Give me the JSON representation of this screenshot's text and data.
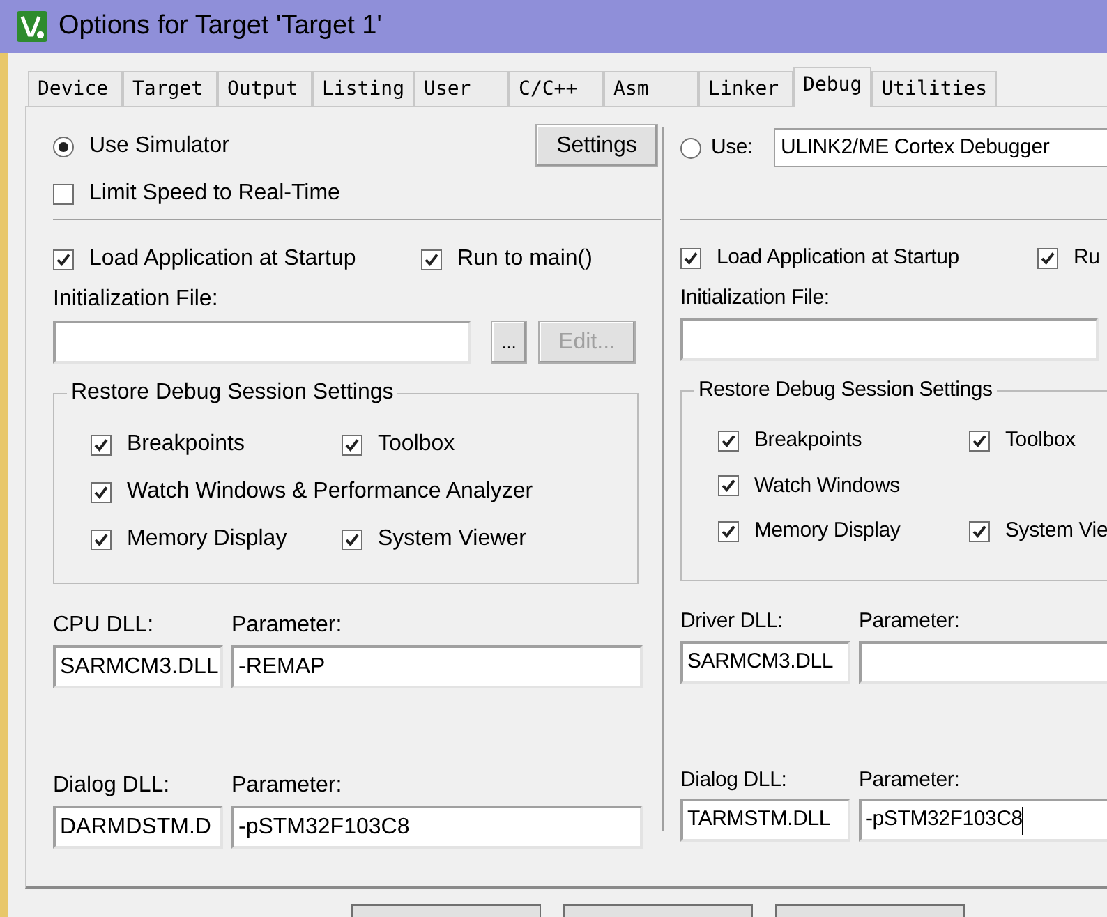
{
  "window": {
    "title": "Options for Target 'Target 1'"
  },
  "tabs": [
    {
      "label": "Device",
      "selected": false
    },
    {
      "label": "Target",
      "selected": false
    },
    {
      "label": "Output",
      "selected": false
    },
    {
      "label": "Listing",
      "selected": false
    },
    {
      "label": "User",
      "selected": false
    },
    {
      "label": "C/C++",
      "selected": false
    },
    {
      "label": "Asm",
      "selected": false
    },
    {
      "label": "Linker",
      "selected": false
    },
    {
      "label": "Debug",
      "selected": true
    },
    {
      "label": "Utilities",
      "selected": false
    }
  ],
  "simulator": {
    "label": "Use Simulator",
    "selected": true,
    "settings_button": "Settings",
    "limit_speed": {
      "label": "Limit Speed to Real-Time",
      "checked": false
    },
    "load_app": {
      "label": "Load Application at Startup",
      "checked": true
    },
    "run_to_main": {
      "label": "Run to main()",
      "checked": true
    },
    "init_file": {
      "label": "Initialization File:",
      "browse_button": "...",
      "edit_button": {
        "label": "Edit...",
        "disabled": true
      }
    },
    "restore": {
      "title": "Restore Debug Session Settings",
      "rows": [
        {
          "items": [
            {
              "label": "Breakpoints",
              "checked": true
            },
            {
              "label": "Toolbox",
              "checked": true
            }
          ]
        },
        {
          "items": [
            {
              "label": "Watch Windows & Performance Analyzer",
              "checked": true
            }
          ]
        },
        {
          "items": [
            {
              "label": "Memory Display",
              "checked": true
            },
            {
              "label": "System Viewer",
              "checked": true
            }
          ]
        }
      ]
    },
    "dlls": [
      {
        "label": "CPU DLL:",
        "value": "SARMCM3.DLL",
        "parameter_label": "Parameter:",
        "parameter": "-REMAP"
      },
      {
        "label": "Dialog DLL:",
        "value": "DARMDSTM.D",
        "parameter_label": "Parameter:",
        "parameter": "-pSTM32F103C8"
      }
    ]
  },
  "debugger": {
    "label": "Use:",
    "selected": false,
    "driver": "ULINK2/ME Cortex Debugger",
    "load_app": {
      "label": "Load Application at Startup",
      "checked": true
    },
    "run_to_main": {
      "label": "Ru",
      "checked": true
    },
    "init_file": {
      "label": "Initialization File:"
    },
    "restore": {
      "title": "Restore Debug Session Settings",
      "rows": [
        {
          "items": [
            {
              "label": "Breakpoints",
              "checked": true
            },
            {
              "label": "Toolbox",
              "checked": true
            }
          ]
        },
        {
          "items": [
            {
              "label": "Watch Windows",
              "checked": true
            }
          ]
        },
        {
          "items": [
            {
              "label": "Memory Display",
              "checked": true
            },
            {
              "label": "System Vie",
              "checked": true
            }
          ]
        }
      ]
    },
    "dlls": [
      {
        "label": "Driver DLL:",
        "value": "SARMCM3.DLL",
        "parameter_label": "Parameter:"
      },
      {
        "label": "Dialog DLL:",
        "value": "TARMSTM.DLL",
        "parameter_label": "Parameter:",
        "parameter": "-pSTM32F103C8",
        "focused": true
      }
    ]
  }
}
